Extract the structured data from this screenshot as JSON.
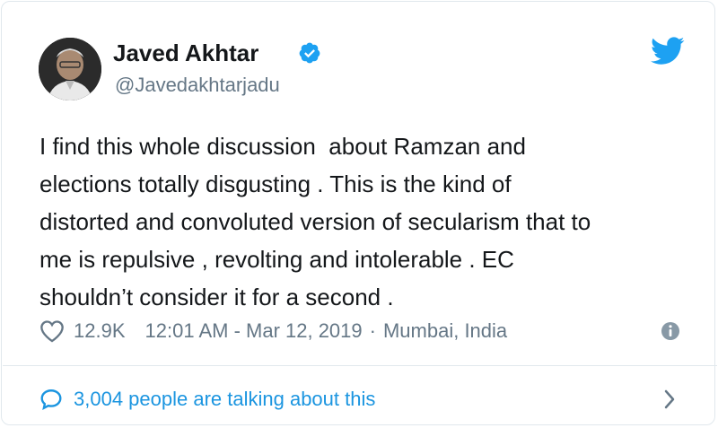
{
  "user": {
    "name": "Javed Akhtar",
    "handle": "@Javedakhtarjadu"
  },
  "tweet": {
    "text": "I find this whole discussion  about Ramzan and\nelections totally disgusting . This is the kind of\ndistorted and convoluted version of secularism that to\nme is repulsive , revolting and intolerable . EC\nshouldn’t consider it for a second .",
    "likes": "12.9K",
    "timestamp": "12:01 AM - Mar 12, 2019",
    "separator": "·",
    "location": "Mumbai, India"
  },
  "footer": {
    "label": "3,004 people are talking about this"
  },
  "colors": {
    "twitter_blue": "#1da1f2",
    "link_blue": "#1b95e0",
    "secondary_text": "#657786",
    "border": "#e1e8ed"
  },
  "icons": [
    "verified-icon",
    "twitter-bird-icon",
    "heart-icon",
    "info-icon",
    "reply-bubble-icon",
    "chevron-right-icon"
  ]
}
